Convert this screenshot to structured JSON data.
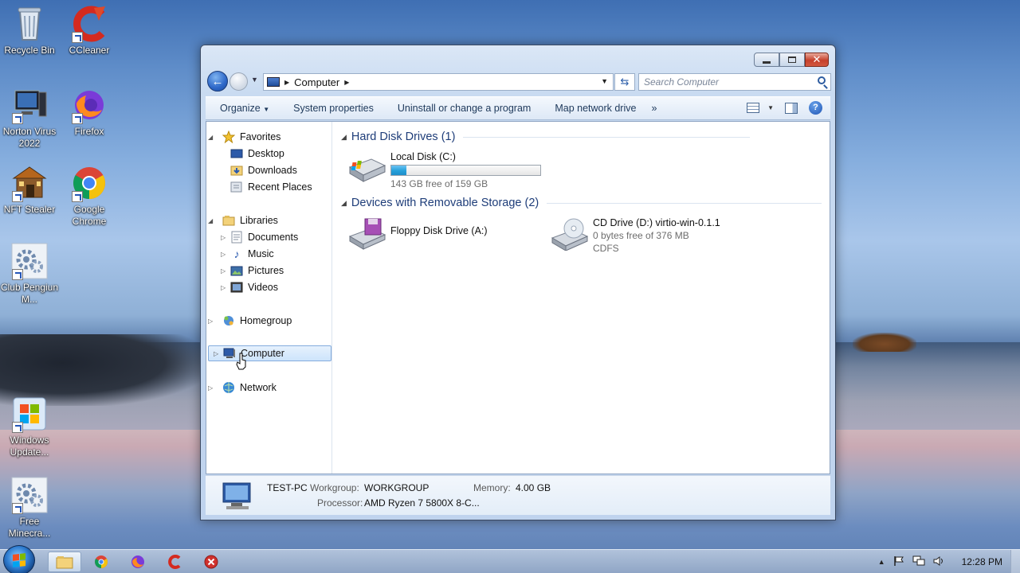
{
  "desktop": {
    "icons": [
      {
        "label": "Recycle Bin"
      },
      {
        "label": "CCleaner"
      },
      {
        "label": "Norton Virus 2022"
      },
      {
        "label": "Firefox"
      },
      {
        "label": "NFT Stealer"
      },
      {
        "label": "Google Chrome"
      },
      {
        "label": "Club Pengiun M..."
      },
      {
        "label": "Windows Update..."
      },
      {
        "label": "Free Minecra..."
      }
    ]
  },
  "window": {
    "title": "Computer",
    "address": {
      "crumb": "Computer"
    },
    "search": {
      "placeholder": "Search Computer"
    },
    "toolbar": {
      "organize": "Organize",
      "system_properties": "System properties",
      "uninstall": "Uninstall or change a program",
      "map_drive": "Map network drive",
      "more": "»"
    },
    "nav": {
      "favorites": "Favorites",
      "desktop": "Desktop",
      "downloads": "Downloads",
      "recent": "Recent Places",
      "libraries": "Libraries",
      "documents": "Documents",
      "music": "Music",
      "pictures": "Pictures",
      "videos": "Videos",
      "homegroup": "Homegroup",
      "computer": "Computer",
      "network": "Network"
    },
    "groups": {
      "hdd": "Hard Disk Drives (1)",
      "removable": "Devices with Removable Storage (2)"
    },
    "drives": {
      "c": {
        "name": "Local Disk (C:)",
        "free": "143 GB free of 159 GB",
        "used_fraction": 0.1
      },
      "a": {
        "name": "Floppy Disk Drive (A:)"
      },
      "d": {
        "name": "CD Drive (D:) virtio-win-0.1.1",
        "free": "0 bytes free of 376 MB",
        "fs": "CDFS"
      }
    },
    "details": {
      "pc_name": "TEST-PC",
      "workgroup_label": "Workgroup:",
      "workgroup": "WORKGROUP",
      "memory_label": "Memory:",
      "memory": "4.00 GB",
      "processor_label": "Processor:",
      "processor": "AMD Ryzen 7 5800X 8-C..."
    }
  },
  "taskbar": {
    "clock": "12:28 PM"
  }
}
